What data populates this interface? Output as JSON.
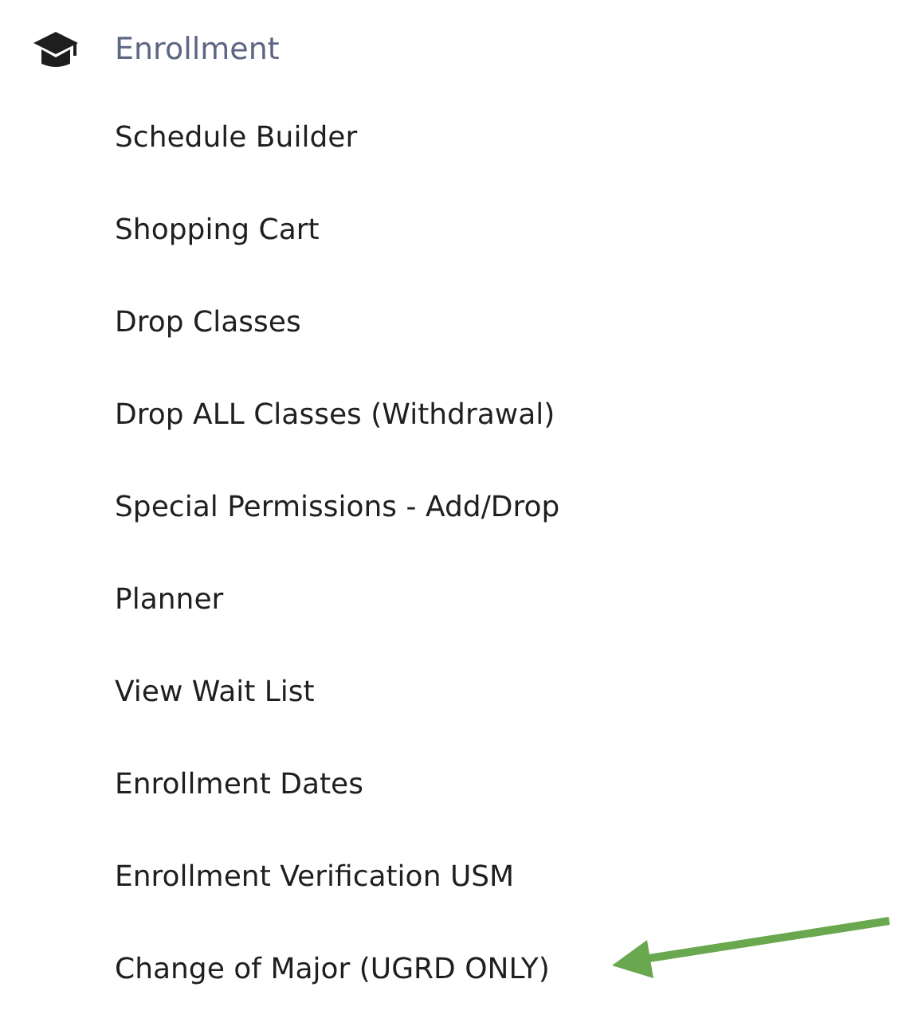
{
  "section": {
    "title": "Enrollment"
  },
  "items": [
    {
      "label": "Schedule Builder"
    },
    {
      "label": "Shopping Cart"
    },
    {
      "label": "Drop Classes"
    },
    {
      "label": "Drop ALL Classes (Withdrawal)"
    },
    {
      "label": "Special Permissions - Add/Drop"
    },
    {
      "label": "Planner"
    },
    {
      "label": "View Wait List"
    },
    {
      "label": "Enrollment Dates"
    },
    {
      "label": "Enrollment Verification USM"
    },
    {
      "label": "Change of Major (UGRD ONLY)"
    }
  ]
}
